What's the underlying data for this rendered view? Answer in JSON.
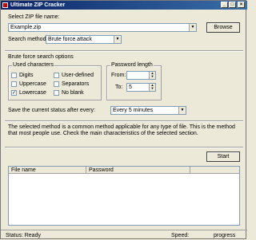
{
  "window": {
    "title": "Ultimate ZIP Cracker"
  },
  "file": {
    "label": "Select ZIP file name:",
    "value": "Example.zip",
    "browse_label": "Browse"
  },
  "method": {
    "label": "Search method:",
    "value": "Brute force attack"
  },
  "options": {
    "section_label": "Brute force search options",
    "charset": {
      "title": "Used characters",
      "items": [
        {
          "label": "Digits",
          "checked": false
        },
        {
          "label": "Uppercase",
          "checked": false
        },
        {
          "label": "Lowercase",
          "checked": true
        },
        {
          "label": "User-defined",
          "checked": false
        },
        {
          "label": "Separators",
          "checked": false
        },
        {
          "label": "No blank",
          "checked": false
        }
      ],
      "check_glyph": "✓"
    },
    "length": {
      "title": "Password length",
      "from_label": "From:",
      "from_value": "",
      "to_label": "To:",
      "to_value": "5"
    },
    "autosave": {
      "label": "Save the current status after every:",
      "value": "Every 5 minutes"
    }
  },
  "description": "The selected method is a common method applicable for any type of file. This is the method that most people use. Check the main characteristics of the selected section.",
  "start_label": "Start",
  "results": {
    "columns": [
      "File name",
      "Password"
    ],
    "rows": []
  },
  "status": {
    "status_text": "Status: Ready",
    "speed_label": "Speed:",
    "progress_label": "progress"
  }
}
